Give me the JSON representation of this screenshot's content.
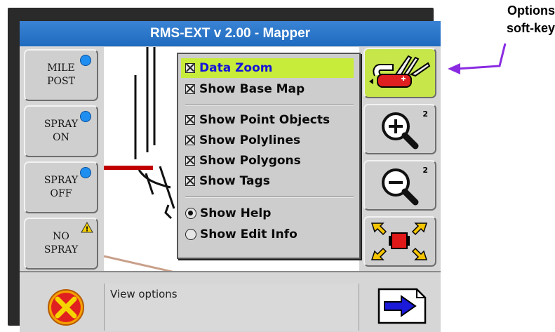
{
  "title": "RMS-EXT v 2.00 - Mapper",
  "left_keys": [
    {
      "label": "MILE\nPOST",
      "indicator": "blue-dot"
    },
    {
      "label": "SPRAY\nON",
      "indicator": "blue-dot"
    },
    {
      "label": "SPRAY\nOFF",
      "indicator": "blue-dot"
    },
    {
      "label": "NO\nSPRAY",
      "indicator": "warning-triangle"
    }
  ],
  "right_keys": [
    {
      "name": "options-button",
      "icon": "swiss-army-knife-icon",
      "active": true
    },
    {
      "name": "zoom-in-button",
      "icon": "zoom-in-icon",
      "sup": "2"
    },
    {
      "name": "zoom-out-button",
      "icon": "zoom-out-icon",
      "sup": "2"
    },
    {
      "name": "zoom-extents-button",
      "icon": "zoom-extents-icon"
    }
  ],
  "menu": {
    "items": [
      {
        "label": "Data Zoom",
        "type": "check",
        "highlighted": true
      },
      {
        "label": "Show Base Map",
        "type": "check"
      },
      {
        "label": "Show Point Objects",
        "type": "check"
      },
      {
        "label": "Show Polylines",
        "type": "check"
      },
      {
        "label": "Show Polygons",
        "type": "check"
      },
      {
        "label": "Show Tags",
        "type": "check"
      },
      {
        "label": "Show Help",
        "type": "radio",
        "selected": true
      },
      {
        "label": "Show Edit Info",
        "type": "radio",
        "selected": false
      }
    ]
  },
  "status_text": "View options",
  "bottom": {
    "cancel_icon": "cancel-x-icon",
    "next_icon": "next-arrow-icon"
  },
  "callout": {
    "line1": "Options",
    "line2": "soft-key"
  },
  "colors": {
    "title_bar": "#2a78cc",
    "highlight": "#c8ec3a",
    "menu_highlight_text": "#1515d8",
    "arrow": "#8a2be2"
  }
}
